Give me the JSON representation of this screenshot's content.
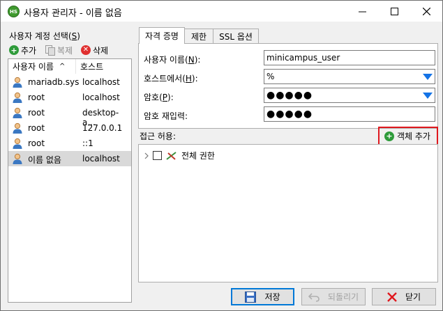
{
  "window": {
    "icon_text": "HS",
    "title": "사용자 관리자 - 이름 없음",
    "minimize_symbol": "—",
    "maximize_symbol": "☐",
    "close_symbol": "✕"
  },
  "left": {
    "section_label": "사용자 계정 선택(S)",
    "section_label_plain": "사용자 계정 선택(",
    "section_label_key": "S",
    "section_label_end": ")",
    "toolbar": {
      "add_label": "추가",
      "copy_label": "복제",
      "delete_label": "삭제"
    },
    "columns": {
      "name": "사용자 이름",
      "sort_indicator": "^",
      "host": "호스트"
    },
    "users": [
      {
        "name": "mariadb.sys",
        "host": "localhost"
      },
      {
        "name": "root",
        "host": "localhost"
      },
      {
        "name": "root",
        "host": "desktop-a..."
      },
      {
        "name": "root",
        "host": "127.0.0.1"
      },
      {
        "name": "root",
        "host": "::1"
      },
      {
        "name": "이름 없음",
        "host": "localhost",
        "selected": true
      }
    ]
  },
  "tabs": [
    {
      "label": "자격 증명",
      "active": true
    },
    {
      "label": "제한",
      "active": false
    },
    {
      "label": "SSL 옵션",
      "active": false
    }
  ],
  "credentials": {
    "username_label": "사용자 이름(",
    "username_key": "N",
    "username_value": "minicampus_user",
    "host_label": "호스트에서(",
    "host_key": "H",
    "host_value": "%",
    "password_label": "암호(",
    "password_key": "P",
    "password_value": "●●●●●",
    "confirm_label": "암호 재입력:",
    "confirm_value": "●●●●●",
    "label_close": "):"
  },
  "access": {
    "label": "접근 허용:",
    "add_object_label": "객체 추가",
    "tree_root_label": "전체 권한"
  },
  "buttons": {
    "save_label": "저장",
    "revert_label": "되돌리기",
    "close_label": "닫기"
  },
  "colors": {
    "add_green": "#2e9b3a",
    "delete_red": "#e03030",
    "highlight_red": "#e0181e",
    "dropdown_blue": "#1473e6"
  }
}
